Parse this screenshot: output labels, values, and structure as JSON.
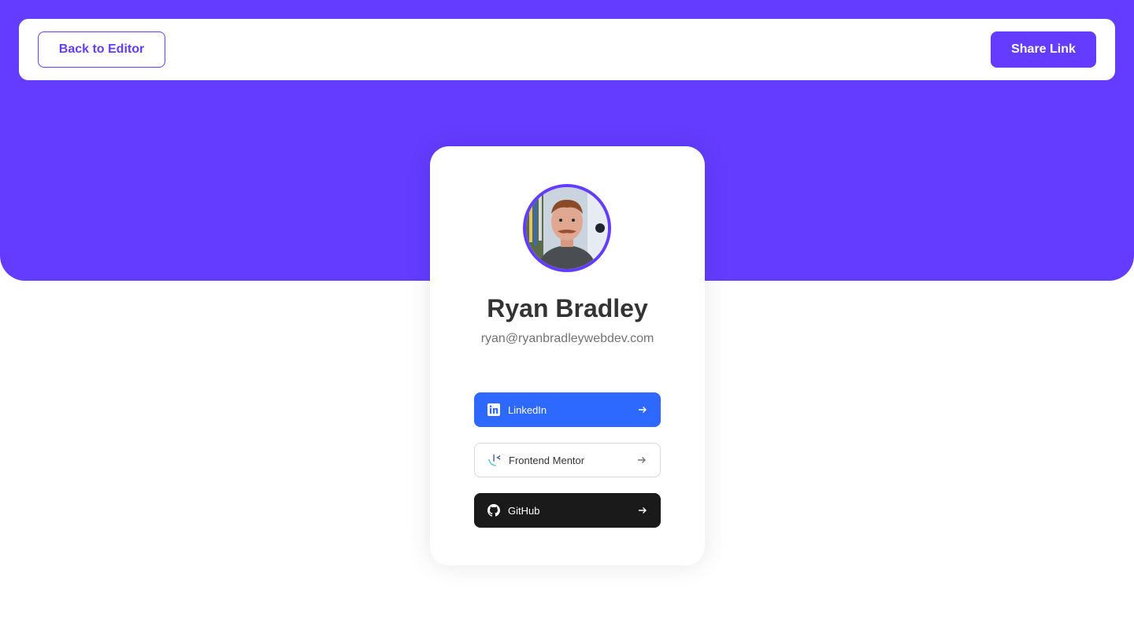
{
  "header": {
    "back_label": "Back to Editor",
    "share_label": "Share Link"
  },
  "profile": {
    "name": "Ryan Bradley",
    "email": "ryan@ryanbradleywebdev.com"
  },
  "links": [
    {
      "label": "LinkedIn",
      "icon": "linkedin-icon",
      "color": "#2d68ff"
    },
    {
      "label": "Frontend Mentor",
      "icon": "frontend-mentor-icon",
      "color": "#ffffff"
    },
    {
      "label": "GitHub",
      "icon": "github-icon",
      "color": "#1a1a1a"
    }
  ],
  "colors": {
    "accent": "#633cff",
    "name_text": "#333333",
    "email_text": "#737373"
  }
}
